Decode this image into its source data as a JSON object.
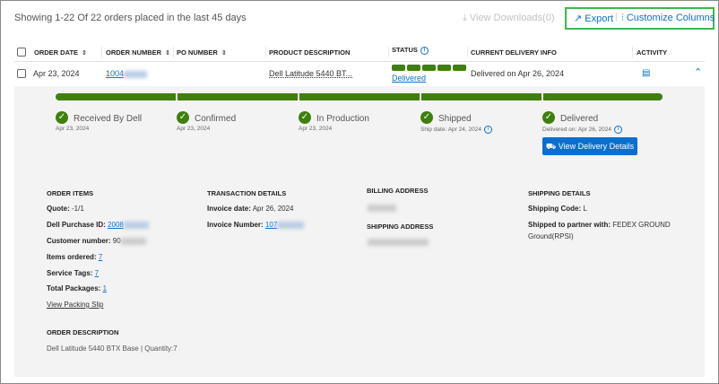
{
  "header": {
    "summary": "Showing 1-22 Of 22 orders placed in the last 45 days",
    "view_downloads": "View Downloads(0)",
    "export": "Export",
    "customize": "Customize Columns"
  },
  "columns": [
    "ORDER DATE",
    "ORDER NUMBER",
    "PO NUMBER",
    "PRODUCT DESCRIPTION",
    "STATUS",
    "CURRENT DELIVERY INFO",
    "ACTIVITY"
  ],
  "row": {
    "order_date": "Apr 23, 2024",
    "order_number": "1004",
    "po_number": "",
    "product": "Dell Latitude 5440 BT...",
    "status": "Delivered",
    "delivery_info": "Delivered on Apr 26, 2024"
  },
  "steps": [
    {
      "label": "Received By Dell",
      "date": "Apr 23, 2024"
    },
    {
      "label": "Confirmed",
      "date": "Apr 23, 2024"
    },
    {
      "label": "In Production",
      "date": "Apr 23, 2024"
    },
    {
      "label": "Shipped",
      "date": "Ship date: Apr 24, 2024"
    },
    {
      "label": "Delivered",
      "date": "Delivered on: Apr 26, 2024"
    }
  ],
  "progress": {
    "completed_steps": 5,
    "total_steps": 5
  },
  "view_delivery": "View Delivery Details",
  "order_items": {
    "title": "ORDER ITEMS",
    "quote_label": "Quote:",
    "quote": "-1/1",
    "purchase_label": "Dell Purchase ID:",
    "purchase_id": "2008",
    "customer_label": "Customer number:",
    "customer": "90",
    "items_label": "Items ordered:",
    "items": "7",
    "tags_label": "Service Tags:",
    "tags": "7",
    "packages_label": "Total Packages:",
    "packages": "1",
    "packing_slip": "View Packing Slip"
  },
  "transaction": {
    "title": "TRANSACTION DETAILS",
    "invoice_date_label": "Invoice date:",
    "invoice_date": "Apr 26, 2024",
    "invoice_number_label": "Invoice Number:",
    "invoice_number": "107"
  },
  "billing": {
    "title": "BILLING ADDRESS"
  },
  "shipping_address": {
    "title": "SHIPPING ADDRESS"
  },
  "shipping": {
    "title": "SHIPPING DETAILS",
    "code_label": "Shipping Code:",
    "code": "L",
    "partner_label": "Shipped to partner with:",
    "partner": "FEDEX GROUND",
    "partner2": "Ground(RPSI)"
  },
  "order_description": {
    "title": "ORDER DESCRIPTION",
    "text": "Dell Latitude 5440 BTX Base | Quantity:7"
  }
}
